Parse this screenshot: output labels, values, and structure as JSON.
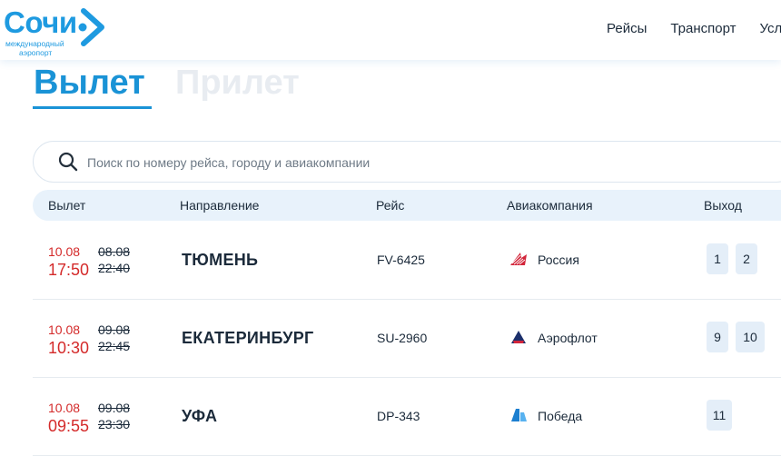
{
  "header": {
    "logo": {
      "name": "Сочи",
      "sub_line1": "международный",
      "sub_line2": "аэропорт",
      "brand_color": "#1e9ae0"
    },
    "nav": [
      "Рейсы",
      "Транспорт",
      "Услуги"
    ]
  },
  "tabs": {
    "departure": "Вылет",
    "arrival": "Прилет",
    "active": "departure"
  },
  "search": {
    "placeholder": "Поиск по номеру рейса, городу и авиакомпании",
    "value": ""
  },
  "table": {
    "columns": [
      "Вылет",
      "Направление",
      "Рейс",
      "Авиакомпания",
      "Выход"
    ],
    "rows": [
      {
        "date_new": "10.08",
        "time_new": "17:50",
        "date_old": "08.08",
        "time_old": "22:40",
        "destination": "ТЮМЕНЬ",
        "flight": "FV-6425",
        "airline": "Россия",
        "airline_icon": "rossiya-logo-icon",
        "gates": [
          "1",
          "2"
        ]
      },
      {
        "date_new": "10.08",
        "time_new": "10:30",
        "date_old": "09.08",
        "time_old": "22:45",
        "destination": "ЕКАТЕРИНБУРГ",
        "flight": "SU-2960",
        "airline": "Аэрофлот",
        "airline_icon": "aeroflot-logo-icon",
        "gates": [
          "9",
          "10"
        ]
      },
      {
        "date_new": "10.08",
        "time_new": "09:55",
        "date_old": "09.08",
        "time_old": "23:30",
        "destination": "УФА",
        "flight": "DP-343",
        "airline": "Победа",
        "airline_icon": "pobeda-logo-icon",
        "gates": [
          "11"
        ]
      }
    ]
  },
  "colors": {
    "accent": "#1a93d6",
    "delay": "#d42a2a",
    "header_row_bg": "#e8f2fb",
    "gate_bg": "#e4eef8"
  }
}
